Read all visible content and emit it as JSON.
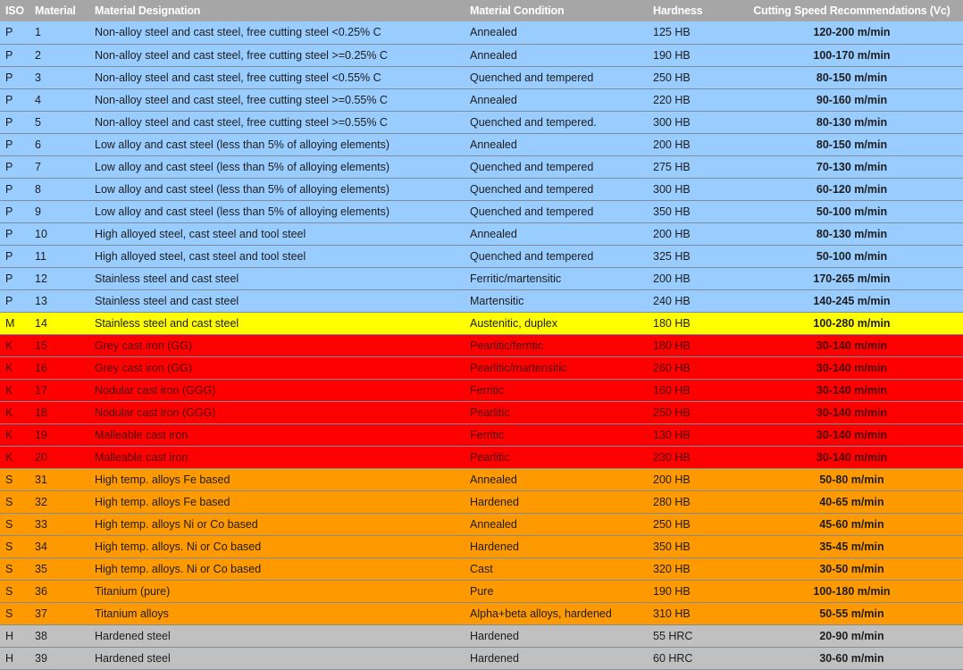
{
  "headers": {
    "iso": "ISO",
    "material": "Material",
    "designation": "Material Designation",
    "condition": "Material Condition",
    "hardness": "Hardness",
    "speed": "Cutting Speed Recommendations (Vc)"
  },
  "colors": {
    "P": "#99ccff",
    "M": "#ffff00",
    "K": "#ff0000",
    "S": "#ff9900",
    "H": "#c0c0c0",
    "header": "#a6a6a6"
  },
  "rows": [
    {
      "iso": "P",
      "material": "1",
      "designation": "Non-alloy steel and cast steel, free cutting steel <0.25% C",
      "condition": "Annealed",
      "hardness": "125 HB",
      "speed": "120-200 m/min"
    },
    {
      "iso": "P",
      "material": "2",
      "designation": "Non-alloy steel and cast steel, free cutting steel >=0.25% C",
      "condition": "Annealed",
      "hardness": "190 HB",
      "speed": "100-170 m/min"
    },
    {
      "iso": "P",
      "material": "3",
      "designation": "Non-alloy steel and cast steel, free cutting steel <0.55% C",
      "condition": "Quenched and tempered",
      "hardness": "250 HB",
      "speed": "80-150 m/min"
    },
    {
      "iso": "P",
      "material": "4",
      "designation": "Non-alloy steel and cast steel, free cutting steel >=0.55% C",
      "condition": "Annealed",
      "hardness": "220 HB",
      "speed": "90-160 m/min"
    },
    {
      "iso": "P",
      "material": "5",
      "designation": "Non-alloy steel and cast steel, free cutting steel >=0.55% C",
      "condition": "Quenched and tempered.",
      "hardness": "300 HB",
      "speed": "80-130 m/min"
    },
    {
      "iso": "P",
      "material": "6",
      "designation": "Low alloy and cast steel (less than 5% of alloying elements)",
      "condition": "Annealed",
      "hardness": "200 HB",
      "speed": "80-150 m/min"
    },
    {
      "iso": "P",
      "material": "7",
      "designation": "Low alloy and cast steel (less than 5% of alloying elements)",
      "condition": "Quenched and tempered",
      "hardness": "275 HB",
      "speed": "70-130 m/min"
    },
    {
      "iso": "P",
      "material": "8",
      "designation": "Low alloy and cast steel (less than 5% of alloying elements)",
      "condition": "Quenched and tempered",
      "hardness": "300 HB",
      "speed": "60-120 m/min"
    },
    {
      "iso": "P",
      "material": "9",
      "designation": "Low alloy and cast steel (less than 5% of alloying elements)",
      "condition": "Quenched and tempered",
      "hardness": "350 HB",
      "speed": "50-100 m/min"
    },
    {
      "iso": "P",
      "material": "10",
      "designation": "High alloyed steel, cast steel and tool steel",
      "condition": "Annealed",
      "hardness": "200 HB",
      "speed": "80-130 m/min"
    },
    {
      "iso": "P",
      "material": "11",
      "designation": "High alloyed steel, cast steel and tool steel",
      "condition": "Quenched and tempered",
      "hardness": "325 HB",
      "speed": "50-100 m/min"
    },
    {
      "iso": "P",
      "material": "12",
      "designation": "Stainless steel and cast steel",
      "condition": "Ferritic/martensitic",
      "hardness": "200 HB",
      "speed": "170-265 m/min"
    },
    {
      "iso": "P",
      "material": "13",
      "designation": "Stainless steel and cast steel",
      "condition": "Martensitic",
      "hardness": "240 HB",
      "speed": "140-245 m/min"
    },
    {
      "iso": "M",
      "material": "14",
      "designation": "Stainless steel and cast steel",
      "condition": "Austenitic, duplex",
      "hardness": "180 HB",
      "speed": "100-280 m/min"
    },
    {
      "iso": "K",
      "material": "15",
      "designation": "Grey cast iron (GG)",
      "condition": "Pearlitic/ferritic",
      "hardness": "180 HB",
      "speed": "30-140 m/min"
    },
    {
      "iso": "K",
      "material": "16",
      "designation": "Grey cast iron (GG)",
      "condition": "Pearlitic/martensitic",
      "hardness": "260 HB",
      "speed": "30-140 m/min"
    },
    {
      "iso": "K",
      "material": "17",
      "designation": "Nodular cast iron (GGG)",
      "condition": "Ferritic",
      "hardness": "160 HB",
      "speed": "30-140 m/min"
    },
    {
      "iso": "K",
      "material": "18",
      "designation": "Nodular cast iron (GGG)",
      "condition": "Pearlitic",
      "hardness": "250 HB",
      "speed": "30-140 m/min"
    },
    {
      "iso": "K",
      "material": "19",
      "designation": "Malleable cast iron",
      "condition": "Ferritic",
      "hardness": "130 HB",
      "speed": "30-140 m/min"
    },
    {
      "iso": "K",
      "material": "20",
      "designation": "Malleable cast iron",
      "condition": "Pearlitic",
      "hardness": "230 HB",
      "speed": "30-140 m/min"
    },
    {
      "iso": "S",
      "material": "31",
      "designation": "High temp. alloys Fe based",
      "condition": "Annealed",
      "hardness": "200 HB",
      "speed": "50-80 m/min"
    },
    {
      "iso": "S",
      "material": "32",
      "designation": "High temp. alloys Fe based",
      "condition": "Hardened",
      "hardness": "280 HB",
      "speed": "40-65 m/min"
    },
    {
      "iso": "S",
      "material": "33",
      "designation": "High temp. alloys Ni or Co based",
      "condition": "Annealed",
      "hardness": "250 HB",
      "speed": "45-60 m/min"
    },
    {
      "iso": "S",
      "material": "34",
      "designation": "High temp. alloys. Ni or Co based",
      "condition": "Hardened",
      "hardness": "350 HB",
      "speed": "35-45 m/min"
    },
    {
      "iso": "S",
      "material": "35",
      "designation": "High temp. alloys. Ni or Co based",
      "condition": "Cast",
      "hardness": "320 HB",
      "speed": "30-50 m/min"
    },
    {
      "iso": "S",
      "material": "36",
      "designation": "Titanium (pure)",
      "condition": "Pure",
      "hardness": "190 HB",
      "speed": "100-180 m/min"
    },
    {
      "iso": "S",
      "material": "37",
      "designation": "Titanium alloys",
      "condition": "Alpha+beta alloys, hardened",
      "hardness": "310 HB",
      "speed": "50-55 m/min"
    },
    {
      "iso": "H",
      "material": "38",
      "designation": "Hardened steel",
      "condition": "Hardened",
      "hardness": "55 HRC",
      "speed": "20-90 m/min"
    },
    {
      "iso": "H",
      "material": "39",
      "designation": "Hardened steel",
      "condition": "Hardened",
      "hardness": "60 HRC",
      "speed": "30-60 m/min"
    }
  ]
}
